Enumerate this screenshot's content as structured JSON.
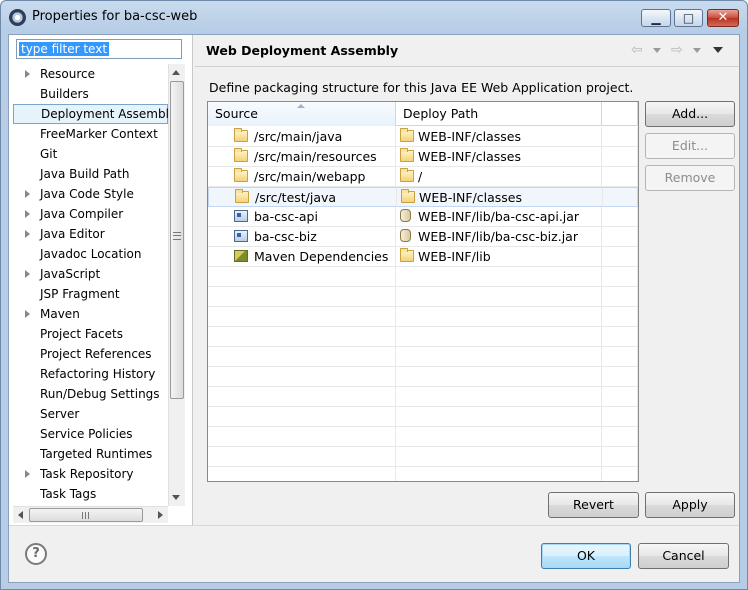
{
  "window": {
    "title": "Properties for ba-csc-web",
    "controls": {
      "minimize": "▁",
      "maximize": "□",
      "close": "✕"
    }
  },
  "filter": {
    "value": "type filter text"
  },
  "tree": {
    "items": [
      {
        "label": "Resource",
        "expandable": true,
        "selected": false
      },
      {
        "label": "Builders",
        "expandable": false,
        "selected": false
      },
      {
        "label": "Deployment Assembly",
        "expandable": false,
        "selected": true
      },
      {
        "label": "FreeMarker Context",
        "expandable": false,
        "selected": false
      },
      {
        "label": "Git",
        "expandable": false,
        "selected": false
      },
      {
        "label": "Java Build Path",
        "expandable": false,
        "selected": false
      },
      {
        "label": "Java Code Style",
        "expandable": true,
        "selected": false
      },
      {
        "label": "Java Compiler",
        "expandable": true,
        "selected": false
      },
      {
        "label": "Java Editor",
        "expandable": true,
        "selected": false
      },
      {
        "label": "Javadoc Location",
        "expandable": false,
        "selected": false
      },
      {
        "label": "JavaScript",
        "expandable": true,
        "selected": false
      },
      {
        "label": "JSP Fragment",
        "expandable": false,
        "selected": false
      },
      {
        "label": "Maven",
        "expandable": true,
        "selected": false
      },
      {
        "label": "Project Facets",
        "expandable": false,
        "selected": false
      },
      {
        "label": "Project References",
        "expandable": false,
        "selected": false
      },
      {
        "label": "Refactoring History",
        "expandable": false,
        "selected": false
      },
      {
        "label": "Run/Debug Settings",
        "expandable": false,
        "selected": false
      },
      {
        "label": "Server",
        "expandable": false,
        "selected": false
      },
      {
        "label": "Service Policies",
        "expandable": false,
        "selected": false
      },
      {
        "label": "Targeted Runtimes",
        "expandable": false,
        "selected": false
      },
      {
        "label": "Task Repository",
        "expandable": true,
        "selected": false
      },
      {
        "label": "Task Tags",
        "expandable": false,
        "selected": false
      }
    ]
  },
  "page": {
    "title": "Web Deployment Assembly",
    "description": "Define packaging structure for this Java EE Web Application project.",
    "nav": {
      "back": "⇦",
      "forward": "⇨"
    }
  },
  "table": {
    "columns": [
      "Source",
      "Deploy Path"
    ],
    "rows": [
      {
        "source": "/src/main/java",
        "source_icon": "folder-icon",
        "deploy": "WEB-INF/classes",
        "deploy_icon": "folder-icon",
        "selected": false
      },
      {
        "source": "/src/main/resources",
        "source_icon": "folder-icon",
        "deploy": "WEB-INF/classes",
        "deploy_icon": "folder-icon",
        "selected": false
      },
      {
        "source": "/src/main/webapp",
        "source_icon": "folder-icon",
        "deploy": "/",
        "deploy_icon": "folder-icon",
        "selected": false
      },
      {
        "source": "/src/test/java",
        "source_icon": "folder-icon",
        "deploy": "WEB-INF/classes",
        "deploy_icon": "folder-icon",
        "selected": true
      },
      {
        "source": "ba-csc-api",
        "source_icon": "project-icon",
        "deploy": "WEB-INF/lib/ba-csc-api.jar",
        "deploy_icon": "jar-icon",
        "selected": false
      },
      {
        "source": "ba-csc-biz",
        "source_icon": "project-icon",
        "deploy": "WEB-INF/lib/ba-csc-biz.jar",
        "deploy_icon": "jar-icon",
        "selected": false
      },
      {
        "source": "Maven Dependencies",
        "source_icon": "maven-library-icon",
        "deploy": "WEB-INF/lib",
        "deploy_icon": "folder-icon",
        "selected": false
      }
    ]
  },
  "buttons": {
    "add": "Add...",
    "edit": "Edit...",
    "remove": "Remove",
    "revert": "Revert",
    "apply": "Apply",
    "ok": "OK",
    "cancel": "Cancel",
    "help": "?"
  }
}
